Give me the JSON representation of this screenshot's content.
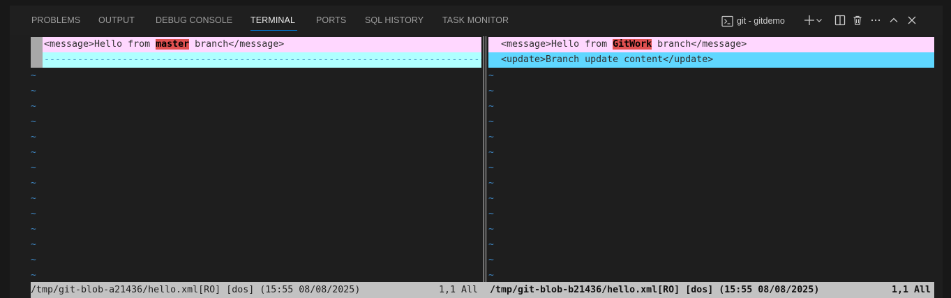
{
  "panel_tabs": [
    {
      "label": "PROBLEMS"
    },
    {
      "label": "OUTPUT"
    },
    {
      "label": "DEBUG CONSOLE"
    },
    {
      "label": "TERMINAL"
    },
    {
      "label": "PORTS"
    },
    {
      "label": "SQL HISTORY"
    },
    {
      "label": "TASK MONITOR"
    }
  ],
  "active_tab": "TERMINAL",
  "terminal_instance": {
    "label": "git - gitdemo",
    "icon": "terminal-icon"
  },
  "controls": [
    "add-terminal-icon",
    "chevron-down-icon",
    "split-terminal-icon",
    "trash-icon",
    "more-icon",
    "maximize-panel-icon",
    "close-icon"
  ],
  "left_pane": {
    "line1": {
      "pre": "<message>Hello from ",
      "highlight": "master",
      "post": " branch</message>"
    },
    "filler_line": "-------------------------------------------------------------------------------------"
  },
  "right_pane": {
    "line1": {
      "pre": "<message>Hello from ",
      "highlight": "GitWork",
      "post": " branch</message>"
    },
    "line2": "<update>Branch update content</update>"
  },
  "tilde": "~",
  "status": {
    "left_file": "/tmp/git-blob-a21436/hello.xml[RO] [dos] (15:55 08/08/2025)",
    "left_pos": "1,1 All",
    "right_file": "/tmp/git-blob-b21436/hello.xml[RO] [dos] (15:55 08/08/2025)",
    "right_pos": "1,1 All"
  },
  "colors": {
    "accent": "#0078d4",
    "changed_line": "#ffd7ff",
    "added_line": "#5fd7ff",
    "deleted_filler": "#afffff",
    "diff_text_highlight": "#e05050",
    "tilde": "#3f88c5"
  }
}
